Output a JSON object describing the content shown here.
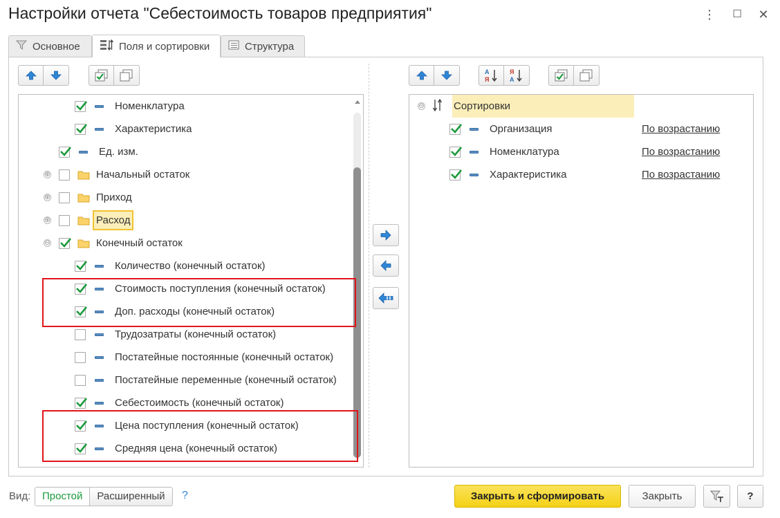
{
  "window": {
    "title": "Настройки отчета \"Себестоимость товаров предприятия\"",
    "more_icon": "⋮",
    "maximize_icon": "☐",
    "close_icon": "✕"
  },
  "tabs": [
    {
      "label": "Основное",
      "icon": "filter-icon"
    },
    {
      "label": "Поля и сортировки",
      "icon": "fields-sort-icon",
      "active": true
    },
    {
      "label": "Структура",
      "icon": "structure-icon"
    }
  ],
  "left_tree": {
    "rows": [
      {
        "label": "Номенклатура",
        "checked": true
      },
      {
        "label": "Характеристика",
        "checked": true
      },
      {
        "label": "Ед. изм.",
        "checked": true
      },
      {
        "label": "Начальный остаток",
        "checked": false,
        "folder": true,
        "expander": "⊕"
      },
      {
        "label": "Приход",
        "checked": false,
        "folder": true,
        "expander": "⊕"
      },
      {
        "label": "Расход",
        "checked": false,
        "folder": true,
        "expander": "⊕",
        "selected": true
      },
      {
        "label": "Конечный остаток",
        "checked": true,
        "folder": true,
        "expander": "⊖"
      },
      {
        "label": "Количество (конечный остаток)",
        "checked": true
      },
      {
        "label": "Стоимость поступления (конечный остаток)",
        "checked": true
      },
      {
        "label": "Доп. расходы (конечный остаток)",
        "checked": true
      },
      {
        "label": "Трудозатраты (конечный остаток)",
        "checked": false
      },
      {
        "label": "Постатейные постоянные (конечный остаток)",
        "checked": false
      },
      {
        "label": "Постатейные переменные (конечный остаток)",
        "checked": false
      },
      {
        "label": "Себестоимость (конечный остаток)",
        "checked": true
      },
      {
        "label": "Цена поступления (конечный остаток)",
        "checked": true
      },
      {
        "label": "Средняя цена (конечный остаток)",
        "checked": true
      }
    ]
  },
  "right_tree": {
    "header": {
      "label": "Сортировки",
      "expander": "⊖"
    },
    "rows": [
      {
        "label": "Организация",
        "checked": true,
        "order": "По возрастанию"
      },
      {
        "label": "Номенклатура",
        "checked": true,
        "order": "По возрастанию"
      },
      {
        "label": "Характеристика",
        "checked": true,
        "order": "По возрастанию"
      }
    ]
  },
  "bottom": {
    "view_label": "Вид:",
    "view_simple": "Простой",
    "view_extended": "Расширенный",
    "help_link": "?",
    "primary_button": "Закрыть и сформировать",
    "close_button": "Закрыть",
    "help_button": "?"
  },
  "colors": {
    "check": "#1c9a3c",
    "arrow": "#2f86d6",
    "primary_bg": "#f9dc3c",
    "highlight": "#fbeeb8",
    "red_frame": "#e0151b",
    "view_active": "#1c9a3c"
  }
}
